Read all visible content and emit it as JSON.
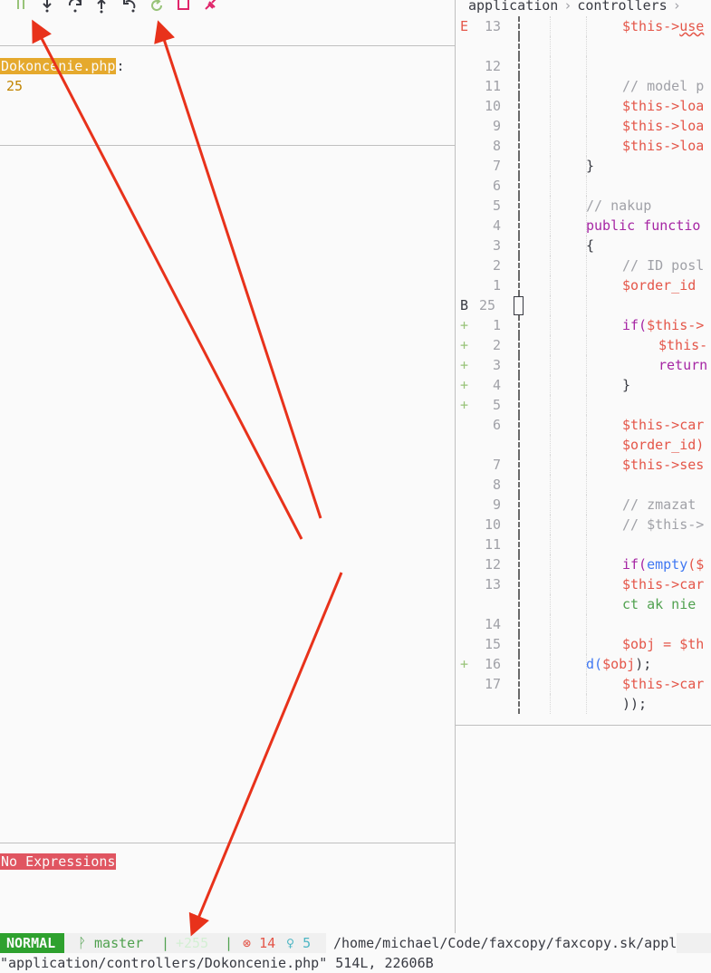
{
  "toolbar": {
    "icons": [
      "pause-icon",
      "step-into-icon",
      "step-over-icon",
      "step-out-icon",
      "step-back-icon",
      "restart-icon",
      "stop-icon",
      "disconnect-icon"
    ]
  },
  "breakpoints": {
    "file": "Dokoncenie.php",
    "colon": ":",
    "line": "25"
  },
  "watches": {
    "empty_label": "No Expressions"
  },
  "editor": {
    "breadcrumb": [
      "application",
      "controllers"
    ],
    "rows": [
      {
        "sign": "E",
        "num": "13",
        "parts": [
          [
            "$this->",
            "var"
          ],
          [
            "use",
            "var"
          ]
        ]
      },
      {
        "sign": "",
        "num": "",
        "parts": []
      },
      {
        "sign": "",
        "num": "12",
        "parts": []
      },
      {
        "sign": "",
        "num": "11",
        "parts": [
          [
            "// model p",
            "com"
          ]
        ]
      },
      {
        "sign": "",
        "num": "10",
        "parts": [
          [
            "$this->",
            "var"
          ],
          [
            "loa",
            "var"
          ]
        ]
      },
      {
        "sign": "",
        "num": "9",
        "parts": [
          [
            "$this->",
            "var"
          ],
          [
            "loa",
            "var"
          ]
        ]
      },
      {
        "sign": "",
        "num": "8",
        "parts": [
          [
            "$this->",
            "var"
          ],
          [
            "loa",
            "var"
          ]
        ]
      },
      {
        "sign": "",
        "num": "7",
        "parts": [
          [
            "}",
            "plain"
          ]
        ]
      },
      {
        "sign": "",
        "num": "6",
        "parts": []
      },
      {
        "sign": "",
        "num": "5",
        "parts": [
          [
            "// nakup",
            "com"
          ]
        ]
      },
      {
        "sign": "",
        "num": "4",
        "parts": [
          [
            "public functio",
            "kw"
          ]
        ]
      },
      {
        "sign": "",
        "num": "3",
        "parts": [
          [
            "{",
            "plain"
          ]
        ]
      },
      {
        "sign": "",
        "num": "2",
        "parts": [
          [
            "// ID posl",
            "com"
          ]
        ]
      },
      {
        "sign": "",
        "num": "1",
        "parts": [
          [
            "$order_id",
            "var"
          ]
        ]
      },
      {
        "sign": "B",
        "num": "25",
        "parts": []
      },
      {
        "sign": "+",
        "num": "1",
        "parts": [
          [
            "if(",
            "kw"
          ],
          [
            "$this->",
            "var"
          ]
        ]
      },
      {
        "sign": "+",
        "num": "2",
        "parts": [
          [
            "$this-",
            "var"
          ]
        ]
      },
      {
        "sign": "+",
        "num": "3",
        "parts": [
          [
            "return",
            "kw"
          ]
        ]
      },
      {
        "sign": "+",
        "num": "4",
        "parts": [
          [
            "}",
            "plain"
          ]
        ]
      },
      {
        "sign": "+",
        "num": "5",
        "parts": []
      },
      {
        "sign": "",
        "num": "6",
        "parts": [
          [
            "$this->",
            "var"
          ],
          [
            "car",
            "var"
          ]
        ]
      },
      {
        "sign": "",
        "num": "",
        "parts": [
          [
            "$order_id)",
            "var"
          ]
        ]
      },
      {
        "sign": "",
        "num": "7",
        "parts": [
          [
            "$this->",
            "var"
          ],
          [
            "ses",
            "var"
          ]
        ]
      },
      {
        "sign": "",
        "num": "8",
        "parts": []
      },
      {
        "sign": "",
        "num": "9",
        "parts": [
          [
            "// zmazat",
            "com"
          ]
        ]
      },
      {
        "sign": "",
        "num": "10",
        "parts": [
          [
            "// $this->",
            "com"
          ]
        ]
      },
      {
        "sign": "",
        "num": "11",
        "parts": []
      },
      {
        "sign": "",
        "num": "12",
        "parts": [
          [
            "if(",
            "kw"
          ],
          [
            "empty",
            "fn"
          ],
          [
            "($",
            "var"
          ]
        ]
      },
      {
        "sign": "",
        "num": "13",
        "parts": [
          [
            "$this->",
            "var"
          ],
          [
            "car",
            "var"
          ]
        ]
      },
      {
        "sign": "",
        "num": "",
        "parts": [
          [
            "ct ak nie",
            "str"
          ]
        ]
      },
      {
        "sign": "",
        "num": "14",
        "parts": []
      },
      {
        "sign": "",
        "num": "15",
        "parts": [
          [
            "$obj = $th",
            "var"
          ]
        ]
      },
      {
        "sign": "+",
        "num": "16",
        "parts": [
          [
            "d(",
            "fn"
          ],
          [
            "$obj",
            "var"
          ],
          [
            ");",
            "plain"
          ]
        ]
      },
      {
        "sign": "",
        "num": "17",
        "parts": [
          [
            "$this->",
            "var"
          ],
          [
            "car",
            "var"
          ]
        ]
      },
      {
        "sign": "",
        "num": "",
        "parts": [
          [
            "));",
            "plain"
          ]
        ]
      }
    ]
  },
  "statusline": {
    "mode": "NORMAL",
    "branch": "master",
    "diff": "+255",
    "errors": "14",
    "hints": "5",
    "path": "/home/michael/Code/faxcopy/faxcopy.sk/appl"
  },
  "message": "\"application/controllers/Dokoncenie.php\" 514L, 22606B",
  "colors": {
    "arrow": "#e8321b",
    "mode_bg": "#2ea12e",
    "breakpoint_bg": "#e5a92d",
    "no_expr_bg": "#e05561"
  }
}
